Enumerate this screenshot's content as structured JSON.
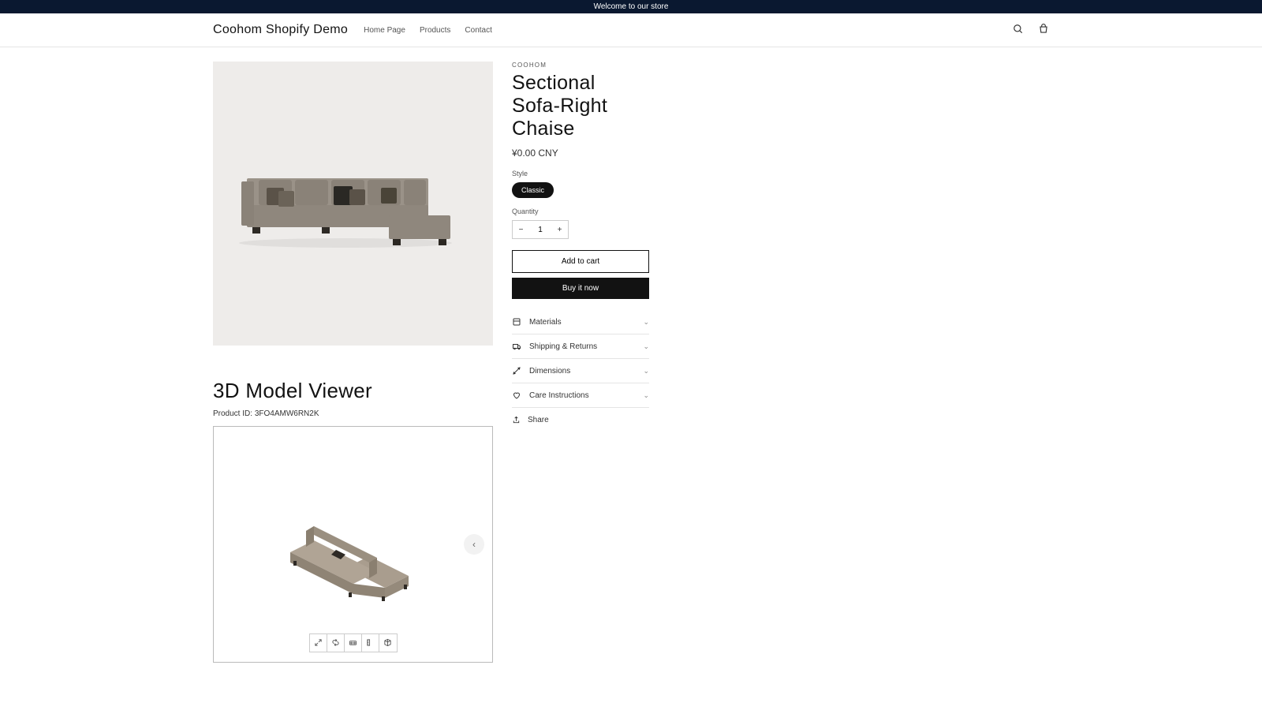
{
  "announcement": "Welcome to our store",
  "header": {
    "logo": "Coohom Shopify Demo",
    "nav": [
      "Home Page",
      "Products",
      "Contact"
    ]
  },
  "product": {
    "vendor": "COOHOM",
    "title": "Sectional Sofa-Right Chaise",
    "price": "¥0.00 CNY",
    "style_label": "Style",
    "style_option": "Classic",
    "quantity_label": "Quantity",
    "quantity_value": "1",
    "add_to_cart": "Add to cart",
    "buy_now": "Buy it now",
    "accordion": {
      "materials": "Materials",
      "shipping": "Shipping & Returns",
      "dimensions": "Dimensions",
      "care": "Care Instructions"
    },
    "share": "Share"
  },
  "viewer": {
    "heading": "3D Model Viewer",
    "product_id_label": "Product ID: ",
    "product_id_value": "3FO4AMW6RN2K"
  }
}
